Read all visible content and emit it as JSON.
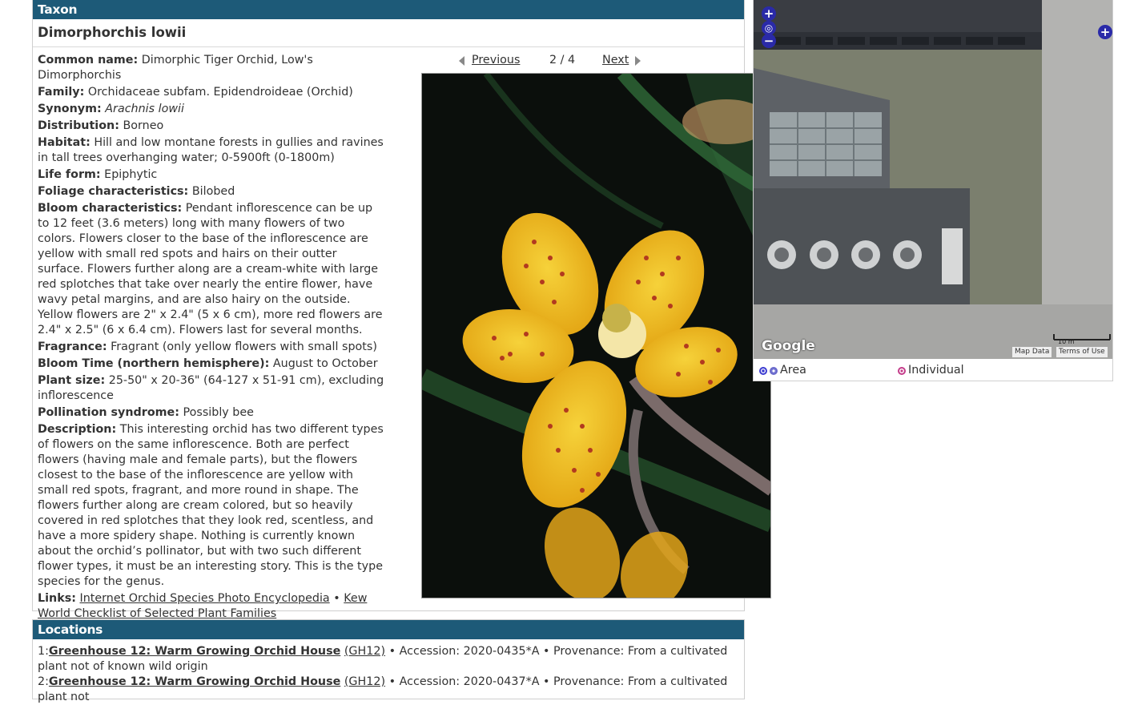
{
  "taxon": {
    "header": "Taxon",
    "name": "Dimorphorchis lowii",
    "details": [
      {
        "label": "Common name:",
        "value": "Dimorphic Tiger Orchid, Low's Dimorphorchis"
      },
      {
        "label": "Family:",
        "value": "Orchidaceae subfam. Epidendroideae (Orchid)"
      },
      {
        "label": "Synonym:",
        "value": "Arachnis lowii"
      },
      {
        "label": "Distribution:",
        "value": "Borneo"
      },
      {
        "label": "Habitat:",
        "value": "Hill and low montane forests in gullies and ravines in tall trees overhanging water; 0-5900ft (0-1800m)"
      },
      {
        "label": "Life form:",
        "value": "Epiphytic"
      },
      {
        "label": "Foliage characteristics:",
        "value": "Bilobed"
      },
      {
        "label": "Bloom characteristics:",
        "value": "Pendant inflorescence can be up to 12 feet (3.6 meters) long with many flowers of two colors. Flowers closer to the base of the inflorescence are yellow with small red spots and hairs on their outter surface. Flowers further along are a cream-white with large red splotches that take over nearly the entire flower, have wavy petal margins, and are also hairy on the outside. Yellow flowers are 2\" x 2.4\" (5 x 6 cm), more red flowers are 2.4\" x 2.5\" (6 x 6.4 cm). Flowers last for several months."
      },
      {
        "label": "Fragrance:",
        "value": "Fragrant (only yellow flowers with small spots)"
      },
      {
        "label": "Bloom Time (northern hemisphere):",
        "value": "August to October"
      },
      {
        "label": "Plant size:",
        "value": "25-50\" x 20-36\" (64-127 x 51-91 cm), excluding inflorescence"
      },
      {
        "label": "Pollination syndrome:",
        "value": "Possibly bee"
      },
      {
        "label": "Description:",
        "value": "This interesting orchid has two different types of flowers on the same inflorescence. Both are perfect flowers (having male and female parts), but the flowers closest to the base of the inflorescence are yellow with small red spots, fragrant, and more round in shape. The flowers further along are cream colored, but so heavily covered in red splotches that they look red, scentless, and have a more spidery shape. Nothing is currently known about the orchid’s pollinator, but with two such different flower types, it must be an interesting story. This is the type species for the genus."
      }
    ],
    "links": {
      "label": "Links:",
      "link1": "Internet Orchid Species Photo Encyclopedia",
      "separator": "•",
      "link2": "Kew World Checklist of Selected Plant Families"
    },
    "gallery": {
      "previous": "Previous",
      "counter": "2 / 4",
      "next": "Next"
    }
  },
  "locations": {
    "header": "Locations",
    "items": [
      {
        "index": "1:",
        "place": "Greenhouse 12: Warm Growing Orchid House",
        "code": "(GH12)",
        "rest": "• Accession: 2020-0435*A • Provenance: From a cultivated plant not of known wild origin"
      },
      {
        "index": "2:",
        "place": "Greenhouse 12: Warm Growing Orchid House",
        "code": "(GH12)",
        "rest": "• Accession: 2020-0437*A • Provenance: From a cultivated plant not"
      }
    ]
  },
  "map": {
    "google_label": "Google",
    "map_data": "Map Data",
    "terms": "Terms of Use",
    "scale": "10 m",
    "zoom_in": "+",
    "zoom_out": "−",
    "expand": "+",
    "legend_area": "Area",
    "legend_individual": "Individual"
  },
  "colors": {
    "header_bg": "#1d5a78",
    "area_marker": "#3b3bd1",
    "individual_marker": "#c43c8a"
  }
}
